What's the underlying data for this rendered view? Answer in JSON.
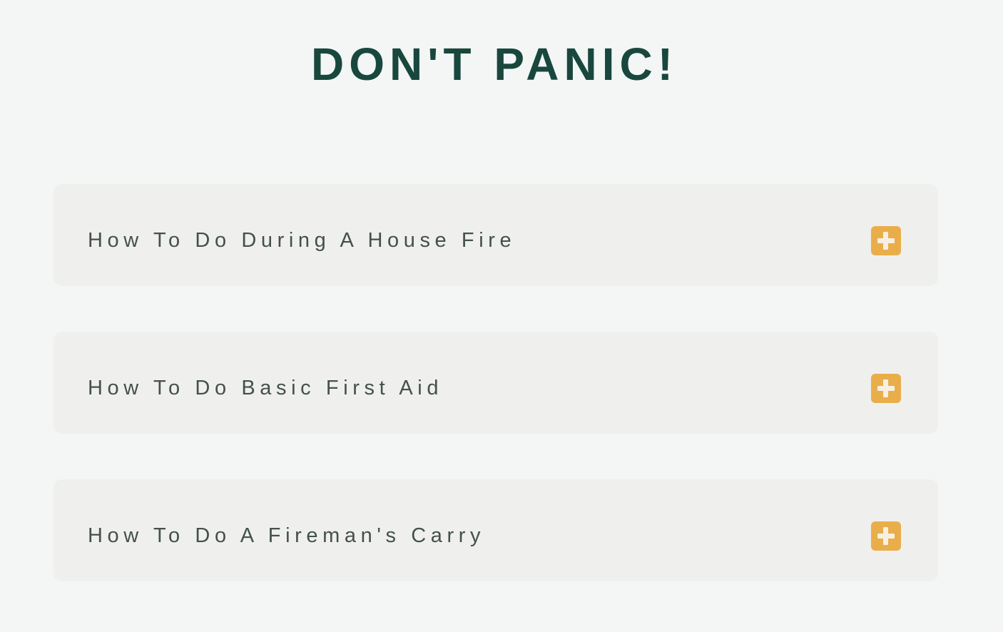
{
  "page": {
    "title": "DON'T PANIC!"
  },
  "accordion": {
    "items": [
      {
        "label": "How To Do During A House Fire",
        "icon": "plus-icon",
        "expanded": false
      },
      {
        "label": "How To Do Basic First Aid",
        "icon": "plus-icon",
        "expanded": false
      },
      {
        "label": "How To Do A Fireman's Carry",
        "icon": "plus-icon",
        "expanded": false
      }
    ]
  },
  "colors": {
    "background": "#f3f6f5",
    "title": "#19473d",
    "item_background": "#eff0ed",
    "item_text": "#44504c",
    "accent": "#e9ae4a"
  }
}
